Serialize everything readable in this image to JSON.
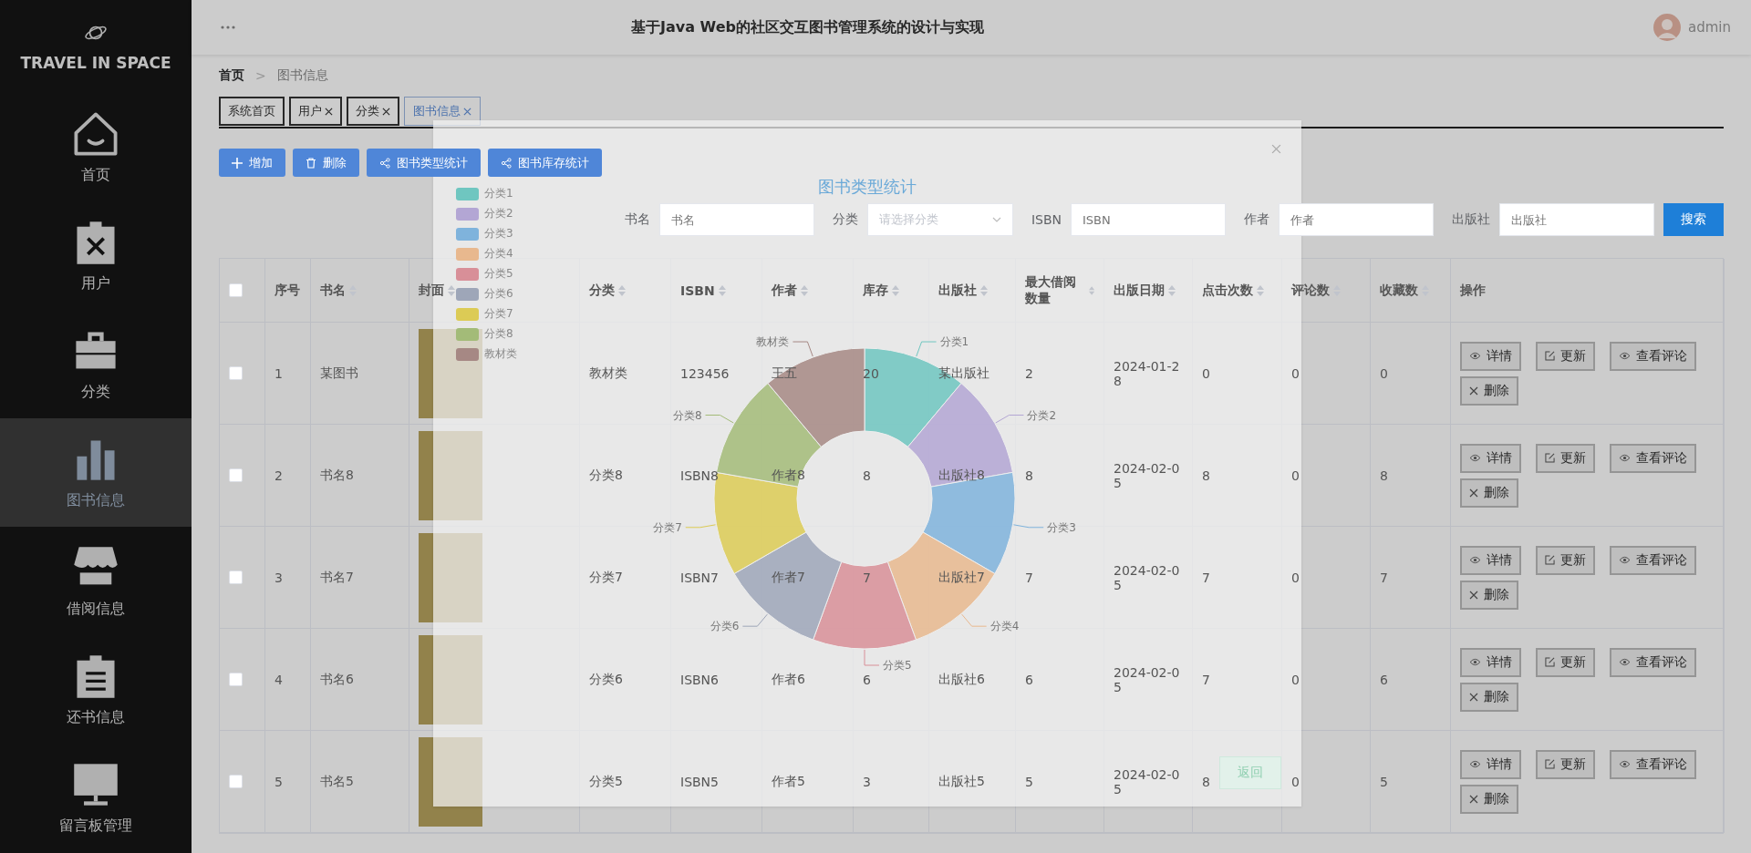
{
  "sidebar": {
    "brand": "TRAVEL IN SPACE",
    "items": [
      {
        "label": "首页",
        "kind": "home",
        "selected": false
      },
      {
        "label": "用户",
        "kind": "user",
        "selected": false
      },
      {
        "label": "分类",
        "kind": "category",
        "selected": false
      },
      {
        "label": "图书信息",
        "kind": "books",
        "selected": true
      },
      {
        "label": "借阅信息",
        "kind": "borrow",
        "selected": false
      },
      {
        "label": "还书信息",
        "kind": "return",
        "selected": false
      },
      {
        "label": "留言板管理",
        "kind": "board",
        "selected": false
      }
    ]
  },
  "header": {
    "title": "基于Java Web的社区交互图书管理系统的设计与实现",
    "user": "admin"
  },
  "breadcrumb": {
    "items": [
      "首页",
      "图书信息"
    ],
    "separator": ">"
  },
  "tabs": [
    {
      "label": "系统首页",
      "closable": false,
      "selected": false
    },
    {
      "label": "用户",
      "closable": true,
      "selected": false
    },
    {
      "label": "分类",
      "closable": true,
      "selected": false
    },
    {
      "label": "图书信息",
      "closable": true,
      "selected": true
    }
  ],
  "toolbar": [
    {
      "label": "增加",
      "kind": "add"
    },
    {
      "label": "删除",
      "kind": "delete"
    },
    {
      "label": "图书类型统计",
      "kind": "chart"
    },
    {
      "label": "图书库存统计",
      "kind": "chart"
    }
  ],
  "search": {
    "fields": [
      {
        "label": "书名",
        "placeholder": "书名",
        "kind": "input"
      },
      {
        "label": "分类",
        "placeholder": "请选择分类",
        "kind": "select"
      },
      {
        "label": "ISBN",
        "placeholder": "ISBN",
        "kind": "input"
      },
      {
        "label": "作者",
        "placeholder": "作者",
        "kind": "input"
      },
      {
        "label": "出版社",
        "placeholder": "出版社",
        "kind": "input"
      }
    ],
    "button": "搜索"
  },
  "table": {
    "select_all": {
      "checked": false
    },
    "columns": [
      {
        "label": "序号",
        "sortable": false
      },
      {
        "label": "书名",
        "sortable": true
      },
      {
        "label": "封面",
        "sortable": true
      },
      {
        "label": "分类",
        "sortable": true
      },
      {
        "label": "ISBN",
        "sortable": true
      },
      {
        "label": "作者",
        "sortable": true
      },
      {
        "label": "库存",
        "sortable": true
      },
      {
        "label": "出版社",
        "sortable": true
      },
      {
        "label": "最大借阅数量",
        "sortable": true
      },
      {
        "label": "出版日期",
        "sortable": true
      },
      {
        "label": "点击次数",
        "sortable": true
      },
      {
        "label": "评论数",
        "sortable": true
      },
      {
        "label": "收藏数",
        "sortable": true
      },
      {
        "label": "操作",
        "sortable": false
      }
    ],
    "rows": [
      {
        "checked": false,
        "index": "1",
        "title": "某图书",
        "category": "教材类",
        "isbn": "123456",
        "author": "王五",
        "stock": "20",
        "publisher": "某出版社",
        "max_borrow": "2",
        "publish_date": "2024-01-28",
        "clicks": "0",
        "comments": "0",
        "favorites": "0",
        "actions": [
          {
            "label": "详情",
            "kind": "view"
          },
          {
            "label": "更新",
            "kind": "edit"
          },
          {
            "label": "查看评论",
            "kind": "view"
          },
          {
            "label": "删除",
            "kind": "delete"
          }
        ]
      },
      {
        "checked": false,
        "index": "2",
        "title": "书名8",
        "category": "分类8",
        "isbn": "ISBN8",
        "author": "作者8",
        "stock": "8",
        "publisher": "出版社8",
        "max_borrow": "8",
        "publish_date": "2024-02-05",
        "clicks": "8",
        "comments": "0",
        "favorites": "8",
        "actions": [
          {
            "label": "详情",
            "kind": "view"
          },
          {
            "label": "更新",
            "kind": "edit"
          },
          {
            "label": "查看评论",
            "kind": "view"
          },
          {
            "label": "删除",
            "kind": "delete"
          }
        ]
      },
      {
        "checked": false,
        "index": "3",
        "title": "书名7",
        "category": "分类7",
        "isbn": "ISBN7",
        "author": "作者7",
        "stock": "7",
        "publisher": "出版社7",
        "max_borrow": "7",
        "publish_date": "2024-02-05",
        "clicks": "7",
        "comments": "0",
        "favorites": "7",
        "actions": [
          {
            "label": "详情",
            "kind": "view"
          },
          {
            "label": "更新",
            "kind": "edit"
          },
          {
            "label": "查看评论",
            "kind": "view"
          },
          {
            "label": "删除",
            "kind": "delete"
          }
        ]
      },
      {
        "checked": false,
        "index": "4",
        "title": "书名6",
        "category": "分类6",
        "isbn": "ISBN6",
        "author": "作者6",
        "stock": "6",
        "publisher": "出版社6",
        "max_borrow": "6",
        "publish_date": "2024-02-05",
        "clicks": "7",
        "comments": "0",
        "favorites": "6",
        "actions": [
          {
            "label": "详情",
            "kind": "view"
          },
          {
            "label": "更新",
            "kind": "edit"
          },
          {
            "label": "查看评论",
            "kind": "view"
          },
          {
            "label": "删除",
            "kind": "delete"
          }
        ]
      },
      {
        "checked": false,
        "index": "5",
        "title": "书名5",
        "category": "分类5",
        "isbn": "ISBN5",
        "author": "作者5",
        "stock": "3",
        "publisher": "出版社5",
        "max_borrow": "5",
        "publish_date": "2024-02-05",
        "clicks": "8",
        "comments": "0",
        "favorites": "5",
        "actions": [
          {
            "label": "详情",
            "kind": "view"
          },
          {
            "label": "更新",
            "kind": "edit"
          },
          {
            "label": "查看评论",
            "kind": "view"
          },
          {
            "label": "删除",
            "kind": "delete"
          }
        ]
      }
    ]
  },
  "dialog": {
    "title": "图书类型统计",
    "back_button": "返回",
    "slices": [
      {
        "legend": "分类1",
        "label": "分类1",
        "color": "#6fc6c0"
      },
      {
        "legend": "分类2",
        "label": "分类2",
        "color": "#b3a6d4"
      },
      {
        "legend": "分类3",
        "label": "分类3",
        "color": "#7fb3dc"
      },
      {
        "legend": "分类4",
        "label": "分类4",
        "color": "#e8b88e"
      },
      {
        "legend": "分类5",
        "label": "分类5",
        "color": "#d88f98"
      },
      {
        "legend": "分类6",
        "label": "分类6",
        "color": "#9ea6b8"
      },
      {
        "legend": "分类7",
        "label": "分类7",
        "color": "#dccb55"
      },
      {
        "legend": "分类8",
        "label": "分类8",
        "color": "#a3bb78"
      },
      {
        "legend": "教材类",
        "label": "教材类",
        "color": "#a68884"
      }
    ]
  }
}
